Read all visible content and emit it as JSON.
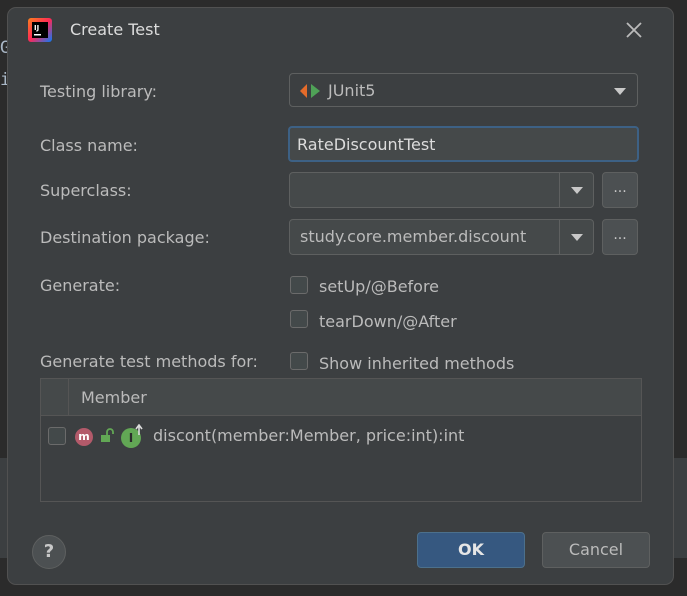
{
  "background": {
    "chars": [
      "G",
      "i"
    ]
  },
  "dialog": {
    "title": "Create Test",
    "app_icon": "intellij-icon",
    "testing_library": {
      "label": "Testing library:",
      "value": "JUnit5",
      "icon": "junit-icon"
    },
    "class_name": {
      "label": "Class name:",
      "value": "RateDiscountTest"
    },
    "superclass": {
      "label": "Superclass:",
      "value": "",
      "browse_label": "..."
    },
    "destination_package": {
      "label": "Destination package:",
      "value": "study.core.member.discount",
      "browse_label": "..."
    },
    "generate": {
      "label": "Generate:",
      "options": [
        {
          "label": "setUp/@Before",
          "checked": false
        },
        {
          "label": "tearDown/@After",
          "checked": false
        }
      ]
    },
    "methods": {
      "label": "Generate test methods for:",
      "show_inherited": {
        "label": "Show inherited methods",
        "checked": false
      },
      "table": {
        "header": "Member",
        "rows": [
          {
            "text": "discont(member:Member, price:int):int",
            "checked": false,
            "icons": [
              "method-icon",
              "unlocked-icon",
              "implements-interface-icon"
            ],
            "icon_letter": "m",
            "interface_letter": "I"
          }
        ]
      }
    },
    "buttons": {
      "help": "?",
      "ok": "OK",
      "cancel": "Cancel"
    },
    "colors": {
      "accent": "#365880",
      "focus_border": "#3d6185",
      "method_icon": "#b35a6a",
      "interface_icon": "#62a755"
    }
  }
}
